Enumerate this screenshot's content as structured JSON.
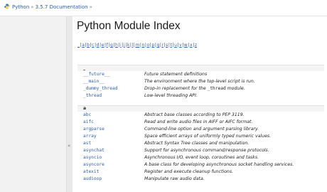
{
  "breadcrumb": {
    "python": "Python",
    "sep1": "»",
    "version": "3.5.7 Documentation",
    "sep2": "»"
  },
  "page": {
    "title": "Python Module Index"
  },
  "collapse_label": "«",
  "letters": [
    "_",
    "a",
    "b",
    "c",
    "d",
    "e",
    "f",
    "g",
    "h",
    "i",
    "j",
    "k",
    "l",
    "m",
    "n",
    "o",
    "p",
    "q",
    "r",
    "s",
    "t",
    "u",
    "v",
    "w",
    "x",
    "z"
  ],
  "groups": [
    {
      "letter": "_",
      "modules": [
        {
          "name": "__future__",
          "desc": "Future statement definitions"
        },
        {
          "name": "__main__",
          "desc": "The environment where the top-level script is run."
        },
        {
          "name": "_dummy_thread",
          "desc_pre": "Drop-in replacement for the ",
          "desc_code": "_thread",
          "desc_post": " module."
        },
        {
          "name": "_thread",
          "desc": "Low-level threading API."
        }
      ]
    },
    {
      "letter": "a",
      "modules": [
        {
          "name": "abc",
          "desc": "Abstract base classes according to PEP 3119."
        },
        {
          "name": "aifc",
          "desc": "Read and write audio files in AIFF or AIFC format."
        },
        {
          "name": "argparse",
          "desc": "Command-line option and argument parsing library."
        },
        {
          "name": "array",
          "desc": "Space efficient arrays of uniformly typed numeric values."
        },
        {
          "name": "ast",
          "desc": "Abstract Syntax Tree classes and manipulation."
        },
        {
          "name": "asynchat",
          "desc": "Support for asynchronous command/response protocols."
        },
        {
          "name": "asyncio",
          "desc": "Asynchronous I/O, event loop, coroutines and tasks."
        },
        {
          "name": "asyncore",
          "desc": "A base class for developing asynchronous socket handling services."
        },
        {
          "name": "atexit",
          "desc": "Register and execute cleanup functions."
        },
        {
          "name": "audioop",
          "desc": "Manipulate raw audio data."
        }
      ]
    }
  ]
}
